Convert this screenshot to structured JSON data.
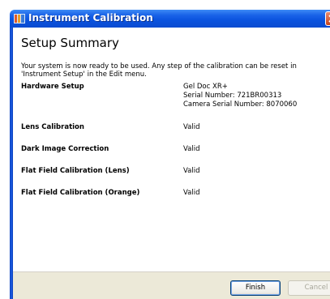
{
  "window": {
    "title": "Instrument Calibration",
    "close_icon": "close-icon"
  },
  "page": {
    "title": "Setup Summary",
    "intro": "Your system is now ready to be used. Any step of the calibration can be reset in 'Instrument Setup' in the Edit menu."
  },
  "rows": [
    {
      "label": "Hardware Setup",
      "values": [
        "Gel Doc XR+",
        "Serial Number: 721BR00313",
        "Camera Serial Number: 8070060"
      ]
    },
    {
      "label": "Lens Calibration",
      "values": [
        "Valid"
      ]
    },
    {
      "label": "Dark Image Correction",
      "values": [
        "Valid"
      ]
    },
    {
      "label": "Flat Field Calibration (Lens)",
      "values": [
        "Valid"
      ]
    },
    {
      "label": "Flat Field Calibration (Orange)",
      "values": [
        "Valid"
      ]
    }
  ],
  "buttons": {
    "finish": "Finish",
    "cancel": "Cancel"
  },
  "colors": {
    "titlebar": "#0a52de",
    "footer": "#ece9d8",
    "close_button": "#c9461d"
  }
}
